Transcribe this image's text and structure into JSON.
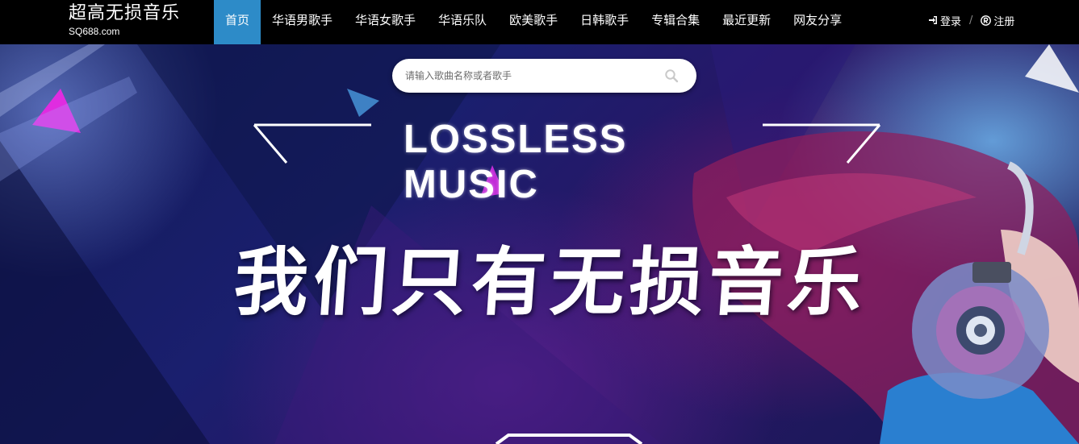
{
  "brand": {
    "title": "超高无损音乐",
    "domain": "SQ688.com"
  },
  "nav": {
    "items": [
      {
        "label": "首页",
        "active": true
      },
      {
        "label": "华语男歌手",
        "active": false
      },
      {
        "label": "华语女歌手",
        "active": false
      },
      {
        "label": "华语乐队",
        "active": false
      },
      {
        "label": "欧美歌手",
        "active": false
      },
      {
        "label": "日韩歌手",
        "active": false
      },
      {
        "label": "专辑合集",
        "active": false
      },
      {
        "label": "最近更新",
        "active": false
      },
      {
        "label": "网友分享",
        "active": false
      }
    ]
  },
  "auth": {
    "login_label": "登录",
    "separator": "/",
    "register_label": "注册",
    "login_icon": "sign-in-icon",
    "register_icon": "registered-icon"
  },
  "search": {
    "placeholder": "请输入歌曲名称或者歌手",
    "icon": "search-icon"
  },
  "hero": {
    "heading": "LOSSLESS MUSIC",
    "slogan": "我们只有无损音乐"
  },
  "colors": {
    "nav_background": "#000000",
    "active_tab": "#2d8bc8",
    "text": "#ffffff"
  }
}
